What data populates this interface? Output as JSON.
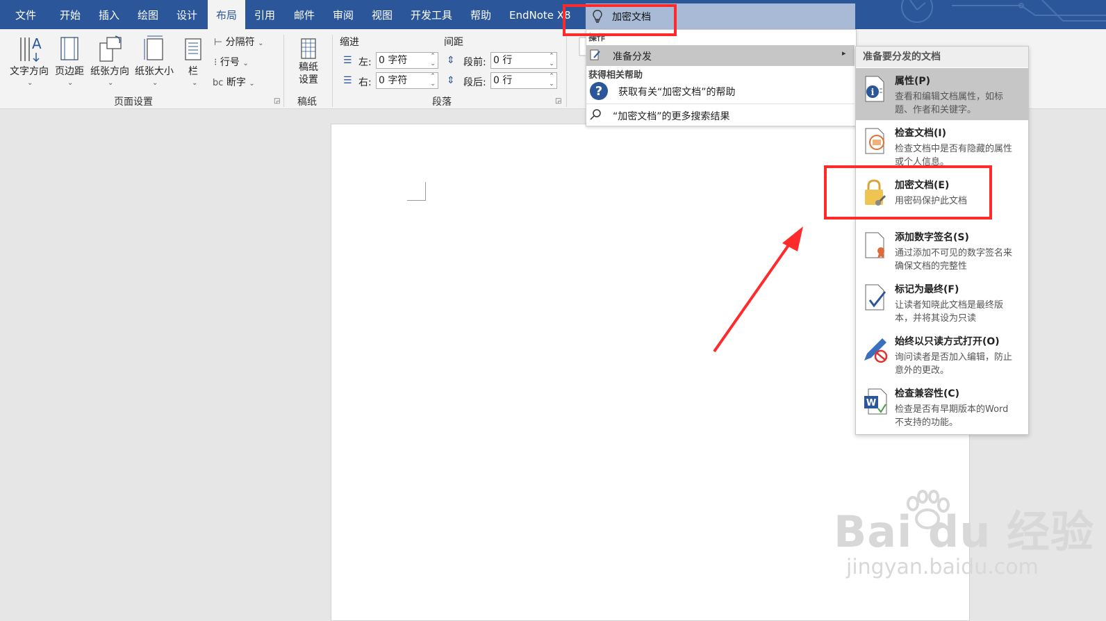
{
  "tabs": {
    "file": "文件",
    "home": "开始",
    "insert": "插入",
    "draw": "绘图",
    "design": "设计",
    "layout": "布局",
    "references": "引用",
    "mailings": "邮件",
    "review": "审阅",
    "view": "视图",
    "developer": "开发工具",
    "help": "帮助",
    "endnote": "EndNote X8"
  },
  "tellme": {
    "query": "加密文档"
  },
  "ribbon": {
    "text_direction": "文字方向",
    "margins": "页边距",
    "orientation": "纸张方向",
    "size": "纸张大小",
    "columns": "栏",
    "breaks": "分隔符",
    "line_numbers": "行号",
    "hyphenation": "断字",
    "page_setup_label": "页面设置",
    "manuscript_setup": [
      "稿纸",
      "设置"
    ],
    "manuscript_label": "稿纸",
    "indent_label": "缩进",
    "spacing_label": "间距",
    "left_label": "左:",
    "right_label": "右:",
    "left_value": "0 字符",
    "right_value": "0 字符",
    "before_label": "段前:",
    "after_label": "段后:",
    "before_value": "0 行",
    "after_value": "0 行",
    "paragraph_label": "段落"
  },
  "tell_dropdown": {
    "section_actions": "操作",
    "prepare_distribute": "准备分发",
    "section_help": "获得相关帮助",
    "help_item": "获取有关“加密文档”的帮助",
    "more_results": "“加密文档”的更多搜索结果"
  },
  "submenu": {
    "header": "准备要分发的文档",
    "items": [
      {
        "title": "属性(P)",
        "desc": "查看和编辑文档属性，如标题、作者和关键字。",
        "icon": "properties-icon"
      },
      {
        "title": "检查文档(I)",
        "desc": "检查文档中是否有隐藏的属性或个人信息。",
        "icon": "inspect-document-icon"
      },
      {
        "title": "加密文档(E)",
        "desc": "用密码保护此文档",
        "icon": "lock-key-icon"
      },
      {
        "title": "添加数字签名(S)",
        "desc": "通过添加不可见的数字签名来确保文档的完整性",
        "icon": "digital-signature-icon"
      },
      {
        "title": "标记为最终(F)",
        "desc": "让读者知晓此文档是最终版本，并将其设为只读",
        "icon": "mark-final-icon"
      },
      {
        "title": "始终以只读方式打开(O)",
        "desc": "询问读者是否加入编辑，防止意外的更改。",
        "icon": "readonly-pencil-icon"
      },
      {
        "title": "检查兼容性(C)",
        "desc": "检查是否有早期版本的Word 不支持的功能。",
        "icon": "compatibility-icon"
      }
    ]
  },
  "watermark": {
    "brand": "Bai du 经验",
    "url": "jingyan.baidu.com"
  },
  "colors": {
    "ribbon_blue": "#2b579a",
    "highlight_red": "#ff2a2a",
    "menu_highlight": "#c6c6c6"
  }
}
